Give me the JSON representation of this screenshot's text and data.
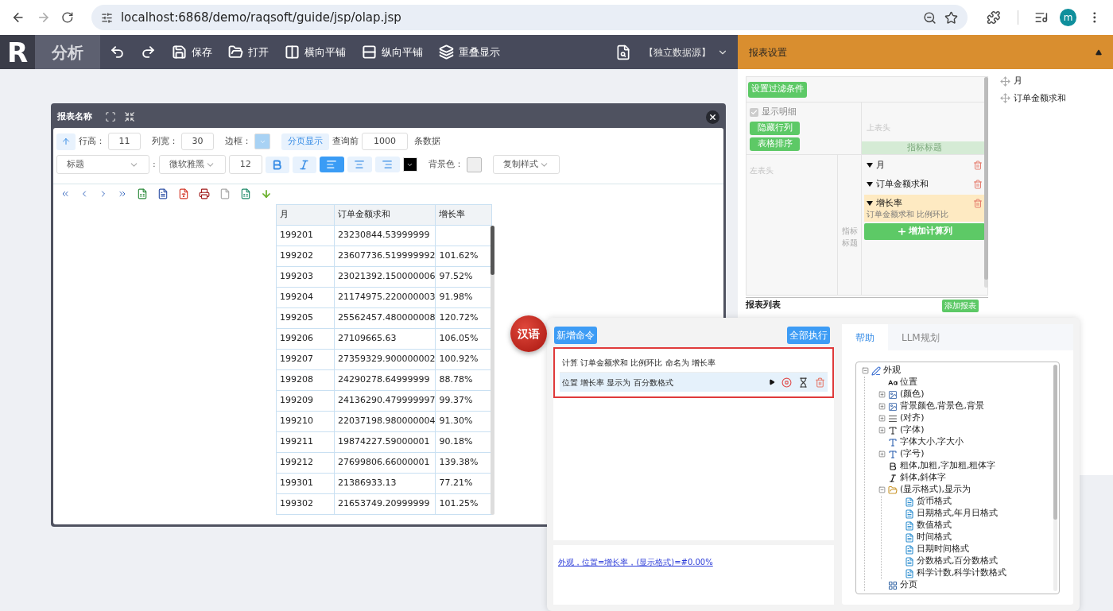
{
  "browser": {
    "url": "localhost:6868/demo/raqsoft/guide/jsp/olap.jsp",
    "avatar": "m"
  },
  "toolbar": {
    "logo": "R",
    "title": "分析",
    "buttons": [
      {
        "kind": "undo"
      },
      {
        "kind": "redo"
      },
      {
        "kind": "save",
        "label": "保存"
      },
      {
        "kind": "open",
        "label": "打开"
      },
      {
        "kind": "tile-h",
        "label": "横向平铺"
      },
      {
        "kind": "tile-v",
        "label": "纵向平铺"
      },
      {
        "kind": "overlap",
        "label": "重叠显示"
      }
    ],
    "datasource": "【独立数据源】"
  },
  "settings": {
    "title": "报表设置",
    "filter_button": "设置过滤条件",
    "show_detail": {
      "label": "显示明细",
      "checked": true
    },
    "buttons": [
      "隐藏行列",
      "表格排序"
    ],
    "top_header": "上表头",
    "indicator_header": "指标标题",
    "left_header": "左表头",
    "indicator_side": "指标标题",
    "indicators": [
      {
        "name": "月",
        "selected": false
      },
      {
        "name": "订单金额求和",
        "selected": false
      },
      {
        "name": "增长率",
        "note": "订单金额求和 比例环比",
        "selected": true
      }
    ],
    "add_column": "增加计算列",
    "report_list": "报表列表",
    "add_report": "添加报表"
  },
  "fields": [
    "月",
    "订单金额求和"
  ],
  "report": {
    "title": "报表名称",
    "row_height": {
      "label": "行高：",
      "value": "11"
    },
    "col_width": {
      "label": "列宽：",
      "value": "30"
    },
    "border_label": "边框：",
    "paging": "分页显示",
    "query_prefix": "查询前",
    "query_count": "1000",
    "query_suffix": "条数据",
    "style_select": "标题",
    "style_separator": ":",
    "font_select": "微软雅黑",
    "font_size": "12",
    "align": [
      {
        "kind": "left",
        "selected": true
      },
      {
        "kind": "center",
        "selected": false
      },
      {
        "kind": "right",
        "selected": false
      }
    ],
    "bg_label": "背景色：",
    "copy_style": "复制样式",
    "columns": [
      "月",
      "订单金额求和",
      "增长率"
    ],
    "rows": [
      [
        "199201",
        "23230844.53999999",
        ""
      ],
      [
        "199202",
        "23607736.519999992",
        "101.62%"
      ],
      [
        "199203",
        "23021392.150000006",
        "97.52%"
      ],
      [
        "199204",
        "21174975.220000003",
        "91.98%"
      ],
      [
        "199205",
        "25562457.480000008",
        "120.72%"
      ],
      [
        "199206",
        "27109665.63",
        "106.05%"
      ],
      [
        "199207",
        "27359329.900000002",
        "100.92%"
      ],
      [
        "199208",
        "24290278.64999999",
        "88.78%"
      ],
      [
        "199209",
        "24136290.479999997",
        "99.37%"
      ],
      [
        "199210",
        "22037198.980000004",
        "91.30%"
      ],
      [
        "199211",
        "19874227.59000001",
        "90.18%"
      ],
      [
        "199212",
        "27699806.66000001",
        "139.38%"
      ],
      [
        "199301",
        "21386933.13",
        "77.21%"
      ],
      [
        "199302",
        "21653749.20999999",
        "101.25%"
      ]
    ]
  },
  "commands": {
    "language": "汉语",
    "new_button": "新增命令",
    "run_all": "全部执行",
    "items": [
      {
        "text": "计算 订单金额求和 比例环比 命名为 增长率",
        "selected": false
      },
      {
        "text": "位置 增长率 显示为 百分数格式",
        "selected": true
      }
    ],
    "formula": "外观，位置=增长率，(显示格式)=#0.00%",
    "tabs": [
      {
        "label": "帮助",
        "selected": true
      },
      {
        "label": "LLM规划",
        "selected": false
      }
    ],
    "tree": [
      {
        "label": "外观",
        "kind": "brush",
        "expanded": true,
        "children": [
          {
            "label": "位置",
            "kind": "aa"
          },
          {
            "label": "(颜色)",
            "kind": "image",
            "expanded": false
          },
          {
            "label": "背景颜色,背景色,背景",
            "kind": "image",
            "expanded": false
          },
          {
            "label": "(对齐)",
            "kind": "align",
            "expanded": false
          },
          {
            "label": "(字体)",
            "kind": "font",
            "expanded": false
          },
          {
            "label": "字体大小,字大小",
            "kind": "size"
          },
          {
            "label": "(字号)",
            "kind": "size",
            "expanded": false
          },
          {
            "label": "粗体,加粗,字加粗,粗体字",
            "kind": "bold"
          },
          {
            "label": "斜体,斜体字",
            "kind": "italic"
          },
          {
            "label": "(显示格式),显示为",
            "kind": "format",
            "expanded": true,
            "children": [
              {
                "label": "货币格式",
                "kind": "doc"
              },
              {
                "label": "日期格式,年月日格式",
                "kind": "doc"
              },
              {
                "label": "数值格式",
                "kind": "doc"
              },
              {
                "label": "时间格式",
                "kind": "doc"
              },
              {
                "label": "日期时间格式",
                "kind": "doc"
              },
              {
                "label": "分数格式,百分数格式",
                "kind": "doc"
              },
              {
                "label": "科学计数,科学计数格式",
                "kind": "doc"
              }
            ]
          },
          {
            "label": "分页",
            "kind": "page"
          }
        ]
      }
    ]
  }
}
